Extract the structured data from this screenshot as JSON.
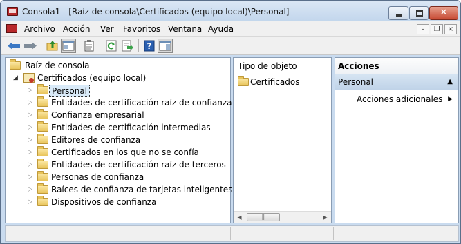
{
  "window": {
    "title": "Consola1 - [Raíz de consola\\Certificados (equipo local)\\Personal]",
    "close_label": "✕"
  },
  "menu": [
    "Archivo",
    "Acción",
    "Ver",
    "Favoritos",
    "Ventana",
    "Ayuda"
  ],
  "tree": {
    "root": "Raíz de consola",
    "snapin": "Certificados (equipo local)",
    "items": [
      "Personal",
      "Entidades de certificación raíz de confianza",
      "Confianza empresarial",
      "Entidades de certificación intermedias",
      "Editores de confianza",
      "Certificados en los que no se confía",
      "Entidades de certificación raíz de terceros",
      "Personas de confianza",
      "Raíces de confianza de tarjetas inteligentes",
      "Dispositivos de confianza"
    ],
    "selected_index": 0
  },
  "list": {
    "column_header": "Tipo de objeto",
    "rows": [
      "Certificados"
    ]
  },
  "actions": {
    "header": "Acciones",
    "section": "Personal",
    "items": [
      "Acciones adicionales"
    ]
  },
  "colors": {
    "titlebar": "#c9dbef",
    "action_section": "#c8d9ec",
    "selection": "#d9eaf8"
  }
}
